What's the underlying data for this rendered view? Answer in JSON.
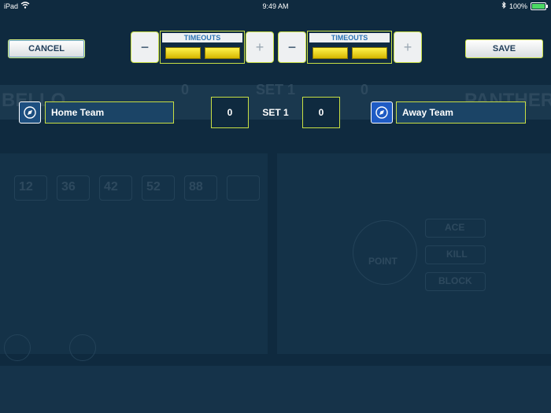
{
  "status_bar": {
    "device": "iPad",
    "time": "9:49 AM",
    "battery": "100%"
  },
  "toolbar": {
    "cancel_label": "CANCEL",
    "save_label": "SAVE"
  },
  "timeouts": {
    "home": {
      "label": "TIMEOUTS",
      "minus": "−",
      "plus": "+",
      "remaining": 2
    },
    "away": {
      "label": "TIMEOUTS",
      "minus": "−",
      "plus": "+",
      "remaining": 2
    }
  },
  "teams": {
    "home": {
      "name": "Home Team",
      "score": "0",
      "icon": "compass-icon"
    },
    "away": {
      "name": "Away Team",
      "score": "0",
      "icon": "compass-icon"
    }
  },
  "set_label": "SET 1",
  "background": {
    "left_team": "BELLO",
    "right_team": "PANTHERS",
    "set_text": "SET 1",
    "left_score": "0",
    "right_score": "0",
    "players": [
      "12",
      "36",
      "42",
      "52",
      "88"
    ],
    "actions": [
      "ACE",
      "KILL",
      "BLOCK"
    ],
    "point_label": "POINT"
  },
  "colors": {
    "background": "#0f2a3f",
    "accent_border": "#c8df44",
    "timeout_active": "#f5e100",
    "home_icon_bg": "#1d4f80",
    "away_icon_bg": "#1f5bc4"
  }
}
